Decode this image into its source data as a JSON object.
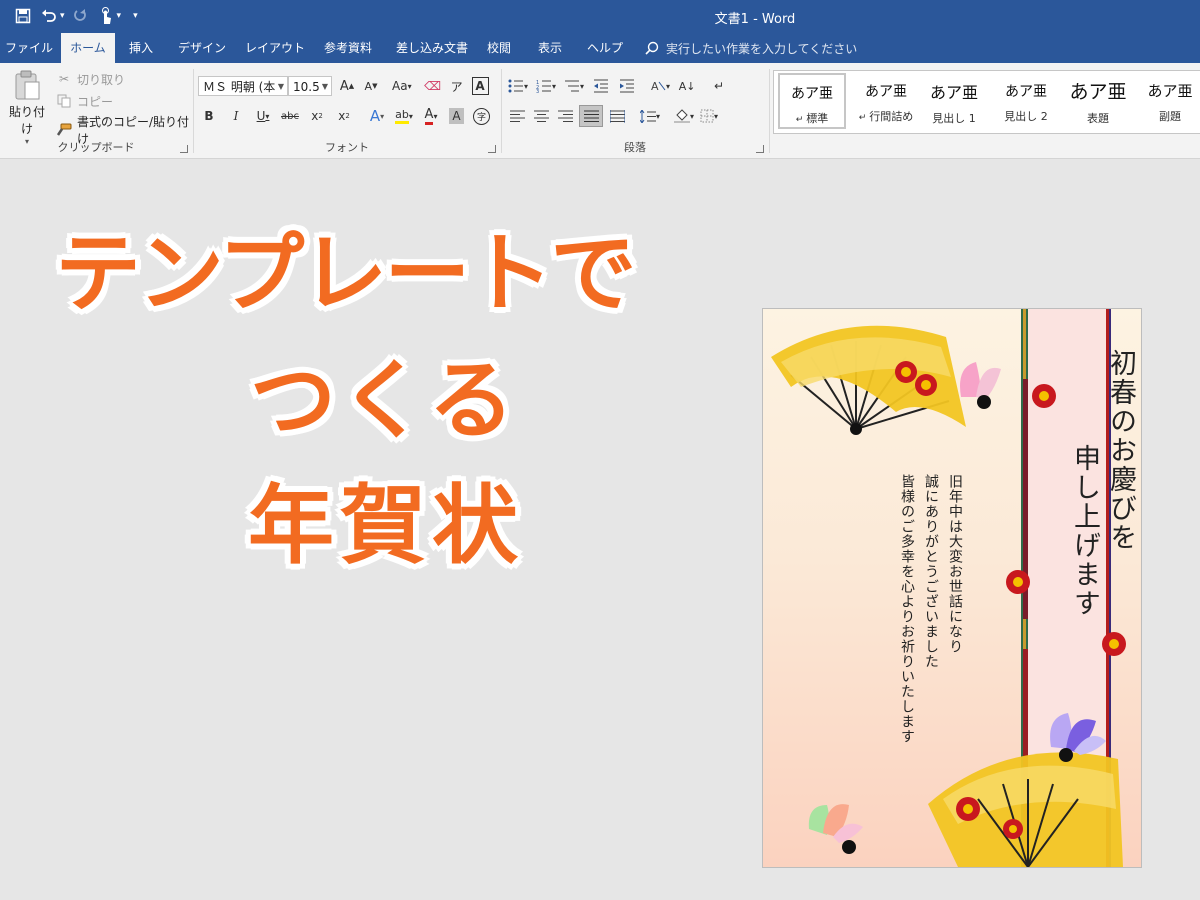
{
  "window": {
    "title": "文書1 - Word"
  },
  "tabs": [
    {
      "label": "ファイル",
      "active": false
    },
    {
      "label": "ホーム",
      "active": true
    },
    {
      "label": "挿入",
      "active": false
    },
    {
      "label": "デザイン",
      "active": false
    },
    {
      "label": "レイアウト",
      "active": false
    },
    {
      "label": "参考資料",
      "active": false
    },
    {
      "label": "差し込み文書",
      "active": false
    },
    {
      "label": "校閲",
      "active": false
    },
    {
      "label": "表示",
      "active": false
    },
    {
      "label": "ヘルプ",
      "active": false
    }
  ],
  "tell_me": {
    "text": "実行したい作業を入力してください"
  },
  "clipboard": {
    "paste": "貼り付け",
    "cut": "切り取り",
    "copy": "コピー",
    "format_painter": "書式のコピー/貼り付け",
    "label": "クリップボード"
  },
  "font": {
    "name": "ＭＳ 明朝 (本",
    "size": "10.5",
    "label": "フォント"
  },
  "paragraph": {
    "label": "段落"
  },
  "styles": [
    {
      "preview": "あア亜",
      "name": "標準",
      "selected": true
    },
    {
      "preview": "あア亜",
      "name": "行間詰め",
      "selected": false
    },
    {
      "preview": "あア亜",
      "name": "見出し 1",
      "selected": false
    },
    {
      "preview": "あア亜",
      "name": "見出し 2",
      "selected": false
    },
    {
      "preview": "あア亜",
      "name": "表題",
      "selected": false
    },
    {
      "preview": "あア亜",
      "name": "副題",
      "selected": false
    }
  ],
  "headline": {
    "line1": "テンプレートで",
    "line2": "つくる",
    "line3": "年賀状"
  },
  "card": {
    "title_line1": "初春のお慶びを",
    "title_line2": "申し上げます",
    "message_line1": "旧年中は大変お世話になり",
    "message_line2": "誠にありがとうございました",
    "message_line3": "皆様のご多幸を心よりお祈りいたします"
  },
  "colors": {
    "word_blue": "#2b579a",
    "headline_orange": "#f26b21",
    "fan_gold": "#f2c522",
    "plum_red": "#c8181e"
  }
}
